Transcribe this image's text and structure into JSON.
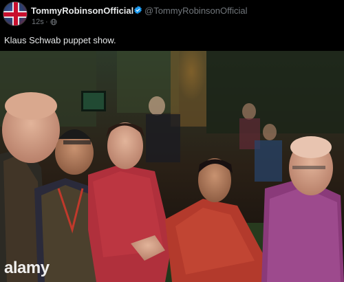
{
  "post": {
    "display_name": "TommyRobinsonOfficial",
    "handle": "@TommyRobinsonOfficial",
    "time": "12s",
    "separator": "·",
    "text": "Klaus Schwab puppet show."
  },
  "media": {
    "watermark": "alamy"
  },
  "colors": {
    "background": "#000000",
    "text": "#e7e9ea",
    "muted": "#71767b",
    "verified": "#1d9bf0"
  },
  "icons": {
    "verified": "verified-badge-icon",
    "audience": "globe-icon"
  }
}
